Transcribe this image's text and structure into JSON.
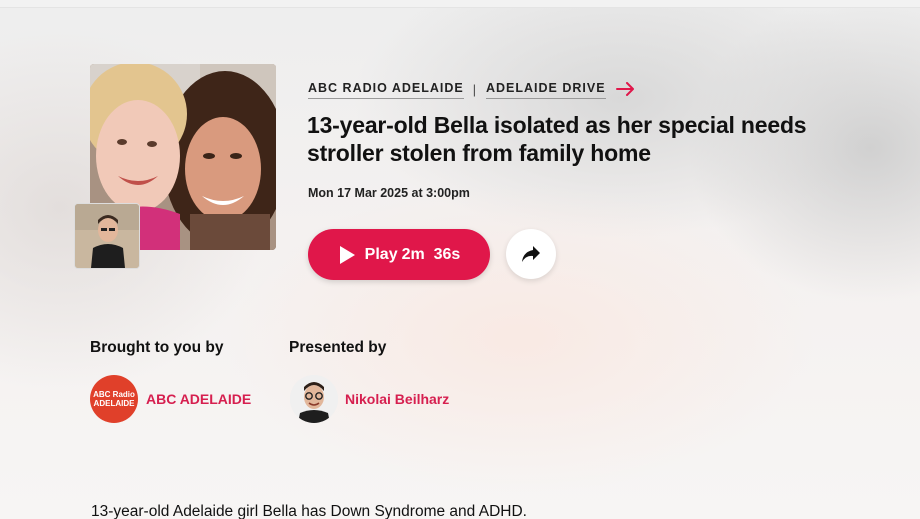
{
  "program": {
    "station_crumb": "ABC RADIO ADELAIDE",
    "separator": "|",
    "show_crumb": "ADELAIDE DRIVE"
  },
  "episode": {
    "title": "13-year-old Bella isolated as her special needs stroller stolen from family home",
    "date": "Mon 17 Mar 2025 at 3:00pm",
    "artwork_icon": "family-photo",
    "presenter_thumb_icon": "presenter-photo"
  },
  "player": {
    "play_label": "Play",
    "duration": "2m  36s",
    "play_icon": "play-icon",
    "share_icon": "share-icon"
  },
  "credits": {
    "brought_by_label": "Brought to you by",
    "station_name": "ABC ADELAIDE",
    "station_logo_line1": "ABC Radio",
    "station_logo_line2": "ADELAIDE",
    "presented_by_label": "Presented by",
    "presenter_name": "Nikolai Beilharz"
  },
  "description": {
    "first_line": "13-year-old Adelaide girl Bella has Down Syndrome and ADHD."
  },
  "colors": {
    "accent": "#e0174a",
    "link": "#d61f4f",
    "station_logo": "#e0402a"
  }
}
